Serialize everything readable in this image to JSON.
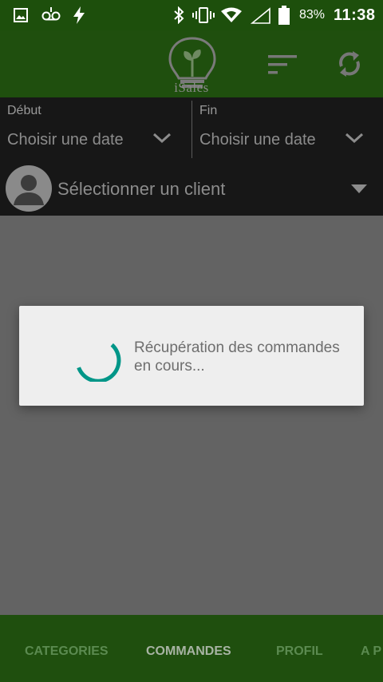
{
  "status_bar": {
    "battery_percent": "83%",
    "time": "11:38",
    "icons": [
      "image-icon",
      "voicemail-icon",
      "flash-icon",
      "bluetooth-icon",
      "vibrate-icon",
      "wifi-icon",
      "signal-icon",
      "battery-icon"
    ]
  },
  "app_bar": {
    "logo_text": "iSales",
    "actions": [
      "sort-icon",
      "sync-icon"
    ]
  },
  "filters": {
    "start": {
      "label": "Début",
      "value": "Choisir une date"
    },
    "end": {
      "label": "Fin",
      "value": "Choisir une date"
    },
    "client": {
      "placeholder": "Sélectionner un client"
    }
  },
  "dialog": {
    "message": "Récupération des commandes en cours..."
  },
  "bottom_nav": {
    "tabs": [
      "CATEGORIES",
      "COMMANDES",
      "PROFIL",
      "A P"
    ],
    "active": "COMMANDES"
  },
  "colors": {
    "app_bar": "#1f4f0e",
    "status_bar": "#1d4f0c",
    "filter_panel": "#171717",
    "overlay": "#636363",
    "dialog": "#eeeeee",
    "spinner": "#009688"
  }
}
